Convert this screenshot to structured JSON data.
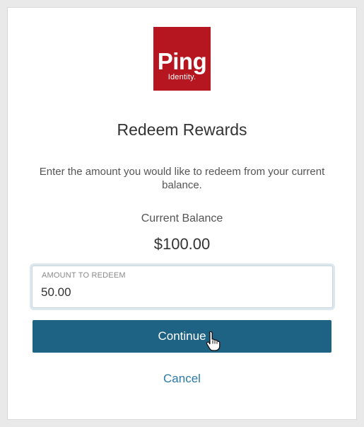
{
  "logo": {
    "word": "Ping",
    "sub": "Identity.",
    "color": "#b5161f"
  },
  "title": "Redeem Rewards",
  "description": "Enter the amount you would like to redeem from your current balance.",
  "balance": {
    "label": "Current Balance",
    "value": "$100.00"
  },
  "amount_field": {
    "label": "AMOUNT TO REDEEM",
    "value": "50.00"
  },
  "continue_label": "Continue",
  "cancel_label": "Cancel",
  "colors": {
    "primary": "#1f6384",
    "link": "#2a7aa8"
  },
  "cursor_icon": "hand-pointer-icon"
}
